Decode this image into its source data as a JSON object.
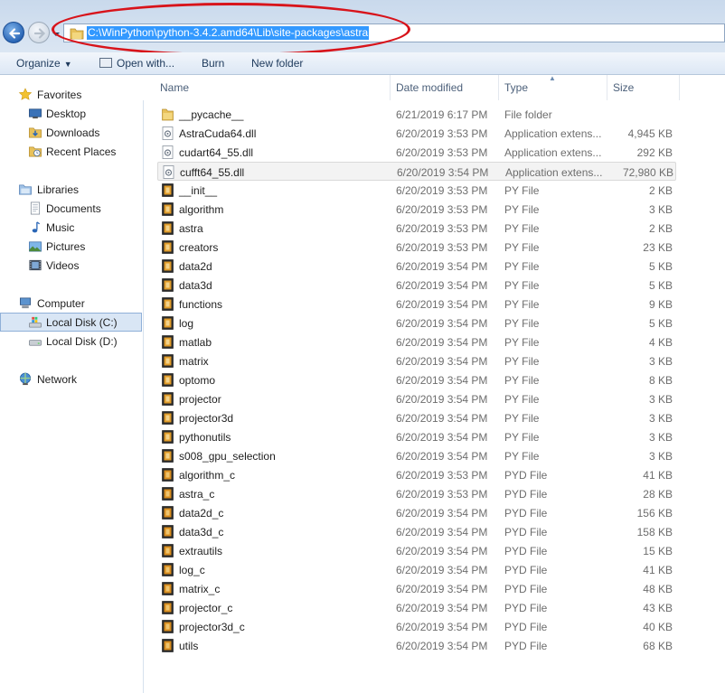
{
  "address_bar": {
    "path": "C:\\WinPython\\python-3.4.2.amd64\\Lib\\site-packages\\astra"
  },
  "toolbar": {
    "organize": "Organize",
    "open_with": "Open with...",
    "burn": "Burn",
    "new_folder": "New folder"
  },
  "nav": {
    "favorites": "Favorites",
    "desktop": "Desktop",
    "downloads": "Downloads",
    "recent_places": "Recent Places",
    "libraries": "Libraries",
    "documents": "Documents",
    "music": "Music",
    "pictures": "Pictures",
    "videos": "Videos",
    "computer": "Computer",
    "local_disk_c": "Local Disk (C:)",
    "local_disk_d": "Local Disk (D:)",
    "network": "Network"
  },
  "columns": {
    "name": "Name",
    "date_modified": "Date modified",
    "type": "Type",
    "size": "Size"
  },
  "colors": {
    "selection_blue": "#3399ff",
    "highlight_red": "#d8131a",
    "nav_selected": "#d9e6f5"
  },
  "files": [
    {
      "name": "__pycache__",
      "date": "6/21/2019 6:17 PM",
      "type": "File folder",
      "size": "",
      "icon": "folder-icon"
    },
    {
      "name": "AstraCuda64.dll",
      "date": "6/20/2019 3:53 PM",
      "type": "Application extens...",
      "size": "4,945 KB",
      "icon": "dll-icon"
    },
    {
      "name": "cudart64_55.dll",
      "date": "6/20/2019 3:53 PM",
      "type": "Application extens...",
      "size": "292 KB",
      "icon": "dll-icon"
    },
    {
      "name": "cufft64_55.dll",
      "date": "6/20/2019 3:54 PM",
      "type": "Application extens...",
      "size": "72,980 KB",
      "icon": "dll-icon"
    },
    {
      "name": "__init__",
      "date": "6/20/2019 3:53 PM",
      "type": "PY File",
      "size": "2 KB",
      "icon": "py-file-icon"
    },
    {
      "name": "algorithm",
      "date": "6/20/2019 3:53 PM",
      "type": "PY File",
      "size": "3 KB",
      "icon": "py-file-icon"
    },
    {
      "name": "astra",
      "date": "6/20/2019 3:53 PM",
      "type": "PY File",
      "size": "2 KB",
      "icon": "py-file-icon"
    },
    {
      "name": "creators",
      "date": "6/20/2019 3:53 PM",
      "type": "PY File",
      "size": "23 KB",
      "icon": "py-file-icon"
    },
    {
      "name": "data2d",
      "date": "6/20/2019 3:54 PM",
      "type": "PY File",
      "size": "5 KB",
      "icon": "py-file-icon"
    },
    {
      "name": "data3d",
      "date": "6/20/2019 3:54 PM",
      "type": "PY File",
      "size": "5 KB",
      "icon": "py-file-icon"
    },
    {
      "name": "functions",
      "date": "6/20/2019 3:54 PM",
      "type": "PY File",
      "size": "9 KB",
      "icon": "py-file-icon"
    },
    {
      "name": "log",
      "date": "6/20/2019 3:54 PM",
      "type": "PY File",
      "size": "5 KB",
      "icon": "py-file-icon"
    },
    {
      "name": "matlab",
      "date": "6/20/2019 3:54 PM",
      "type": "PY File",
      "size": "4 KB",
      "icon": "py-file-icon"
    },
    {
      "name": "matrix",
      "date": "6/20/2019 3:54 PM",
      "type": "PY File",
      "size": "3 KB",
      "icon": "py-file-icon"
    },
    {
      "name": "optomo",
      "date": "6/20/2019 3:54 PM",
      "type": "PY File",
      "size": "8 KB",
      "icon": "py-file-icon"
    },
    {
      "name": "projector",
      "date": "6/20/2019 3:54 PM",
      "type": "PY File",
      "size": "3 KB",
      "icon": "py-file-icon"
    },
    {
      "name": "projector3d",
      "date": "6/20/2019 3:54 PM",
      "type": "PY File",
      "size": "3 KB",
      "icon": "py-file-icon"
    },
    {
      "name": "pythonutils",
      "date": "6/20/2019 3:54 PM",
      "type": "PY File",
      "size": "3 KB",
      "icon": "py-file-icon"
    },
    {
      "name": "s008_gpu_selection",
      "date": "6/20/2019 3:54 PM",
      "type": "PY File",
      "size": "3 KB",
      "icon": "py-file-icon"
    },
    {
      "name": "algorithm_c",
      "date": "6/20/2019 3:53 PM",
      "type": "PYD File",
      "size": "41 KB",
      "icon": "pyd-file-icon"
    },
    {
      "name": "astra_c",
      "date": "6/20/2019 3:53 PM",
      "type": "PYD File",
      "size": "28 KB",
      "icon": "pyd-file-icon"
    },
    {
      "name": "data2d_c",
      "date": "6/20/2019 3:54 PM",
      "type": "PYD File",
      "size": "156 KB",
      "icon": "pyd-file-icon"
    },
    {
      "name": "data3d_c",
      "date": "6/20/2019 3:54 PM",
      "type": "PYD File",
      "size": "158 KB",
      "icon": "pyd-file-icon"
    },
    {
      "name": "extrautils",
      "date": "6/20/2019 3:54 PM",
      "type": "PYD File",
      "size": "15 KB",
      "icon": "pyd-file-icon"
    },
    {
      "name": "log_c",
      "date": "6/20/2019 3:54 PM",
      "type": "PYD File",
      "size": "41 KB",
      "icon": "pyd-file-icon"
    },
    {
      "name": "matrix_c",
      "date": "6/20/2019 3:54 PM",
      "type": "PYD File",
      "size": "48 KB",
      "icon": "pyd-file-icon"
    },
    {
      "name": "projector_c",
      "date": "6/20/2019 3:54 PM",
      "type": "PYD File",
      "size": "43 KB",
      "icon": "pyd-file-icon"
    },
    {
      "name": "projector3d_c",
      "date": "6/20/2019 3:54 PM",
      "type": "PYD File",
      "size": "40 KB",
      "icon": "pyd-file-icon"
    },
    {
      "name": "utils",
      "date": "6/20/2019 3:54 PM",
      "type": "PYD File",
      "size": "68 KB",
      "icon": "pyd-file-icon"
    }
  ]
}
